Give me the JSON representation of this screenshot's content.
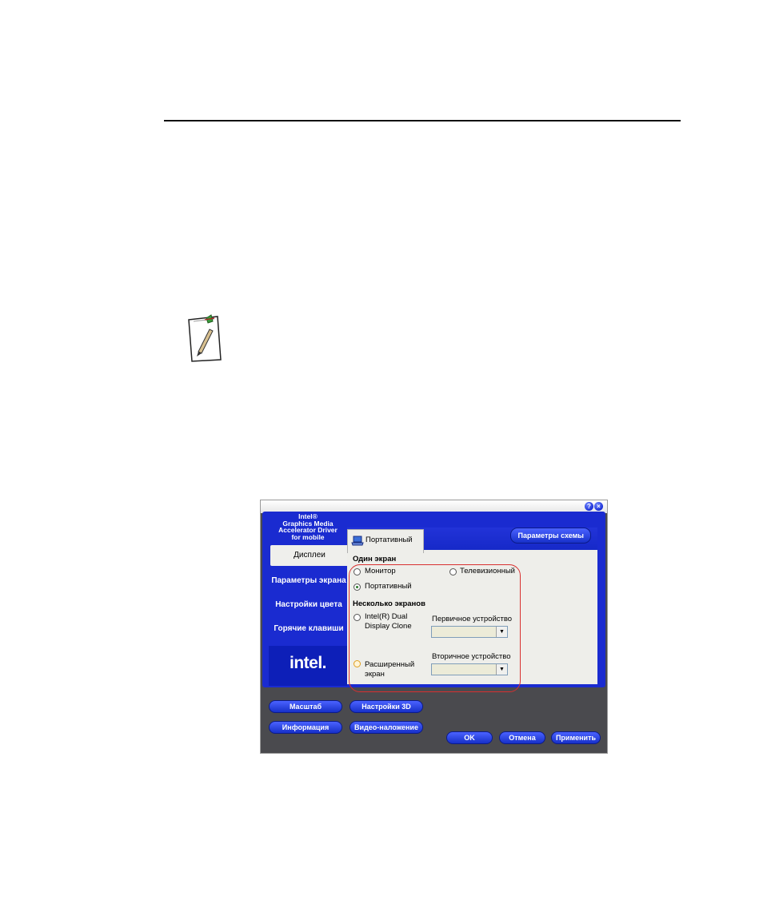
{
  "dialog": {
    "brand_lines": [
      "Intel®",
      "Graphics Media",
      "Accelerator Driver",
      "for mobile"
    ],
    "title_buttons": {
      "help": "?",
      "close": "×"
    },
    "sidebar": {
      "items": [
        {
          "label": "Дисплеи"
        },
        {
          "label": "Параметры экрана"
        },
        {
          "label": "Настройки цвета"
        },
        {
          "label": "Горячие клавиши"
        }
      ],
      "logo": "intel."
    },
    "tab": {
      "label": "Портативный"
    },
    "scheme_button": "Параметры схемы",
    "single_display": {
      "heading": "Один экран",
      "monitor": "Монитор",
      "tv": "Телевизионный",
      "notebook": "Портативный"
    },
    "multi_display": {
      "heading": "Несколько экранов",
      "clone_line1": "Intel(R) Dual",
      "clone_line2": "Display Clone",
      "primary_label": "Первичное устройство",
      "extended_line1": "Расширенный",
      "extended_line2": "экран",
      "secondary_label": "Вторичное устройство"
    },
    "bottom_buttons": {
      "scale": "Масштаб",
      "settings3d": "Настройки 3D",
      "info": "Информация",
      "overlay": "Видео-наложение",
      "ok": "OK",
      "cancel": "Отмена",
      "apply": "Применить"
    }
  }
}
